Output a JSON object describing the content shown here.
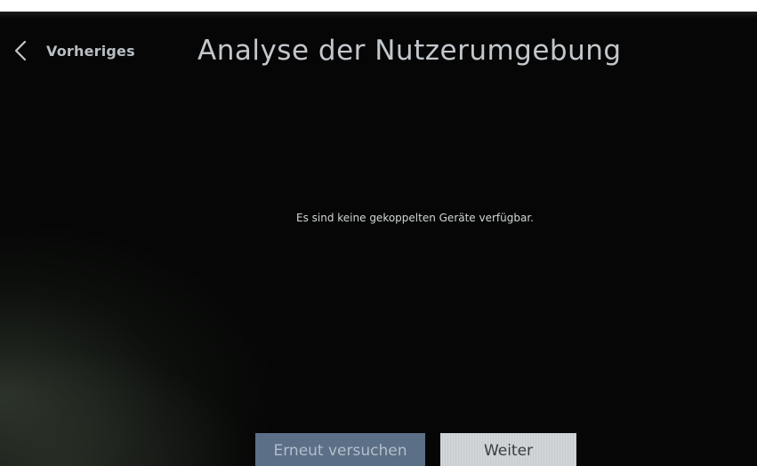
{
  "header": {
    "back_label": "Vorheriges",
    "title": "Analyse der Nutzerumgebung"
  },
  "main": {
    "message": "Es sind keine gekoppelten Geräte verfügbar."
  },
  "footer": {
    "retry_label": "Erneut versuchen",
    "next_label": "Weiter"
  },
  "icons": {
    "back": "chevron-left-icon"
  },
  "colors": {
    "background": "#050605",
    "retry_button": "#5b6f86",
    "next_button": "#d3d6d9"
  }
}
